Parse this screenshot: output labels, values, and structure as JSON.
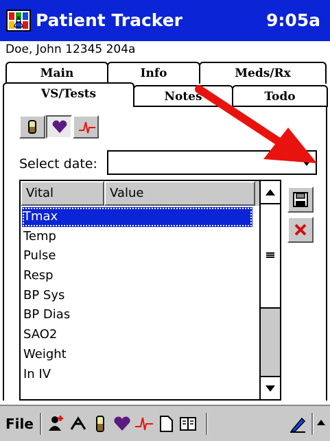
{
  "title_bar": {
    "app_title": "Patient Tracker",
    "clock": "9:05a"
  },
  "patient_info": "Doe, John 12345 204a",
  "tabs": {
    "back_row": [
      {
        "label": "Main"
      },
      {
        "label": "Info"
      },
      {
        "label": "Meds/Rx"
      }
    ],
    "front_row": [
      {
        "label": "VS/Tests",
        "active": true
      },
      {
        "label": "Notes",
        "active": false
      },
      {
        "label": "Todo",
        "active": false
      }
    ]
  },
  "category_buttons": [
    {
      "icon": "test-tube-icon",
      "pressed": false
    },
    {
      "icon": "heart-icon",
      "pressed": true
    },
    {
      "icon": "ekg-icon",
      "pressed": false
    }
  ],
  "date_select": {
    "label": "Select date:",
    "value": ""
  },
  "vitals_grid": {
    "columns": [
      "Vital",
      "Value"
    ],
    "rows": [
      {
        "vital": "Tmax",
        "value": "",
        "selected": true
      },
      {
        "vital": "Temp",
        "value": ""
      },
      {
        "vital": "Pulse",
        "value": ""
      },
      {
        "vital": "Resp",
        "value": ""
      },
      {
        "vital": "BP Sys",
        "value": ""
      },
      {
        "vital": "BP Dias",
        "value": ""
      },
      {
        "vital": "SAO2",
        "value": ""
      },
      {
        "vital": "Weight",
        "value": ""
      },
      {
        "vital": "In IV",
        "value": ""
      }
    ]
  },
  "side_buttons": [
    {
      "icon": "save-disk-icon"
    },
    {
      "icon": "delete-x-icon"
    }
  ],
  "bottom_bar": {
    "file_label": "File"
  },
  "colors": {
    "titlebar": "#0b24d6",
    "selection": "#0b24d6",
    "annotation_arrow": "#e8130f",
    "toolbar": "#c9c9c9"
  }
}
